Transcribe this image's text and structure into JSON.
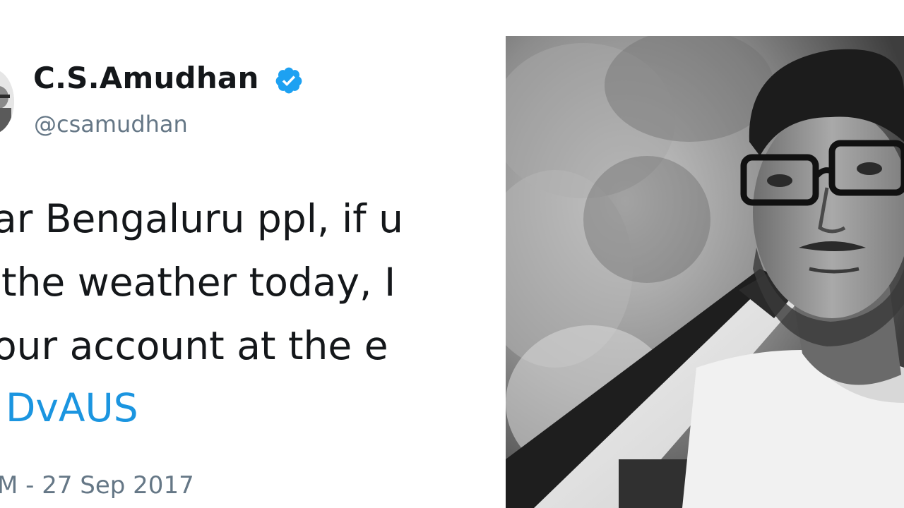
{
  "tweet": {
    "author": {
      "display_name": "C.S.Amudhan",
      "handle": "@csamudhan",
      "verified_icon": "verified-badge-icon",
      "avatar": "profile-avatar"
    },
    "text_lines": [
      "ar Bengaluru ppl, if u",
      "the weather today, I",
      "our account at the e",
      "DvAUS"
    ],
    "timestamp": "M - 27 Sep 2017",
    "colors": {
      "name": "#14171a",
      "secondary": "#657786",
      "hashtag": "#1b95e0",
      "verified": "#1da1f2"
    }
  },
  "photo": {
    "subject": "black-and-white portrait of a man with glasses beside a car",
    "style": "grayscale"
  }
}
